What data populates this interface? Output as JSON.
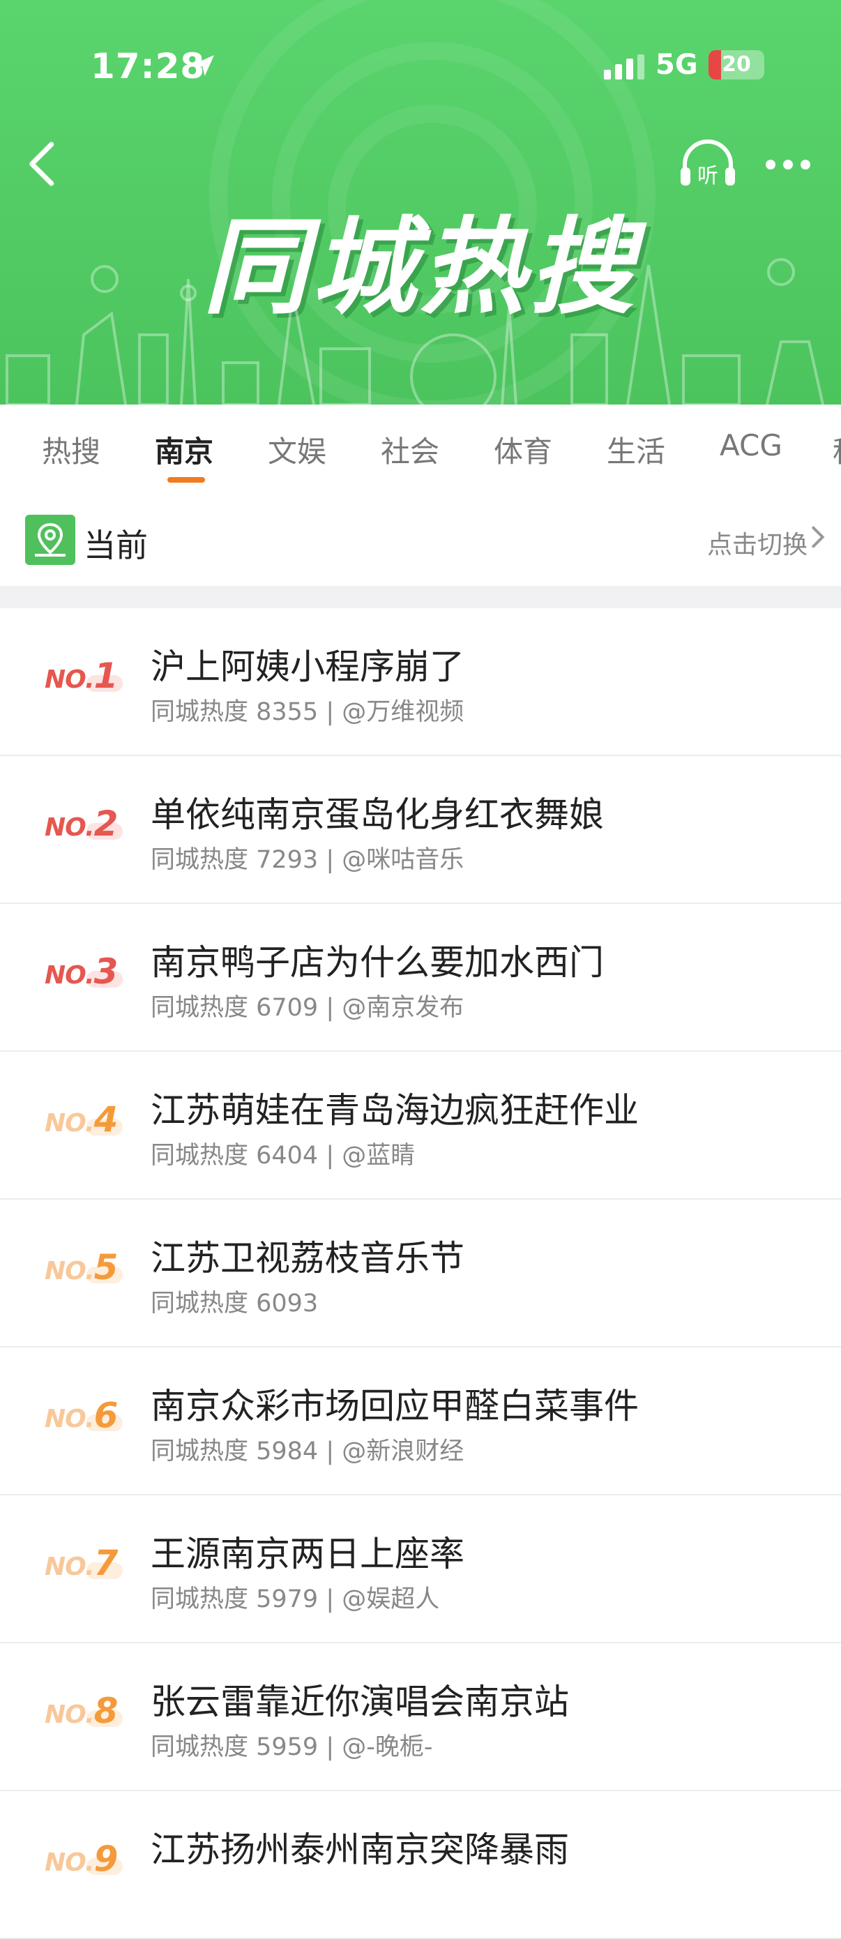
{
  "status_bar": {
    "time": "17:28",
    "network": "5G",
    "battery": "20"
  },
  "header": {
    "banner_title": "同城热搜",
    "listen_label": "听"
  },
  "tabs": [
    {
      "label": "热搜",
      "active": false
    },
    {
      "label": "南京",
      "active": true
    },
    {
      "label": "文娱",
      "active": false
    },
    {
      "label": "社会",
      "active": false
    },
    {
      "label": "体育",
      "active": false
    },
    {
      "label": "生活",
      "active": false
    },
    {
      "label": "ACG",
      "active": false
    },
    {
      "label": "科",
      "active": false
    }
  ],
  "location": {
    "label": "当前",
    "switch_label": "点击切换"
  },
  "colors": {
    "header_green": "#53cc66",
    "accent_orange": "#f27a21",
    "rank_top": "#e5574f",
    "rank_mid": "#f59a3b"
  },
  "list": [
    {
      "rank_prefix": "NO.",
      "rank": "1",
      "title": "沪上阿姨小程序崩了",
      "meta": "同城热度 8355 | @万维视频"
    },
    {
      "rank_prefix": "NO.",
      "rank": "2",
      "title": "单依纯南京蛋岛化身红衣舞娘",
      "meta": "同城热度 7293 | @咪咕音乐"
    },
    {
      "rank_prefix": "NO.",
      "rank": "3",
      "title": "南京鸭子店为什么要加水西门",
      "meta": "同城热度 6709 | @南京发布"
    },
    {
      "rank_prefix": "NO.",
      "rank": "4",
      "title": "江苏萌娃在青岛海边疯狂赶作业",
      "meta": "同城热度 6404 | @蓝睛"
    },
    {
      "rank_prefix": "NO.",
      "rank": "5",
      "title": "江苏卫视荔枝音乐节",
      "meta": "同城热度 6093"
    },
    {
      "rank_prefix": "NO.",
      "rank": "6",
      "title": "南京众彩市场回应甲醛白菜事件",
      "meta": "同城热度 5984 | @新浪财经"
    },
    {
      "rank_prefix": "NO.",
      "rank": "7",
      "title": "王源南京两日上座率",
      "meta": "同城热度 5979 | @娱超人"
    },
    {
      "rank_prefix": "NO.",
      "rank": "8",
      "title": "张云雷靠近你演唱会南京站",
      "meta": "同城热度 5959 | @-晚栀-"
    },
    {
      "rank_prefix": "NO.",
      "rank": "9",
      "title": "江苏扬州泰州南京突降暴雨",
      "meta": ""
    }
  ]
}
